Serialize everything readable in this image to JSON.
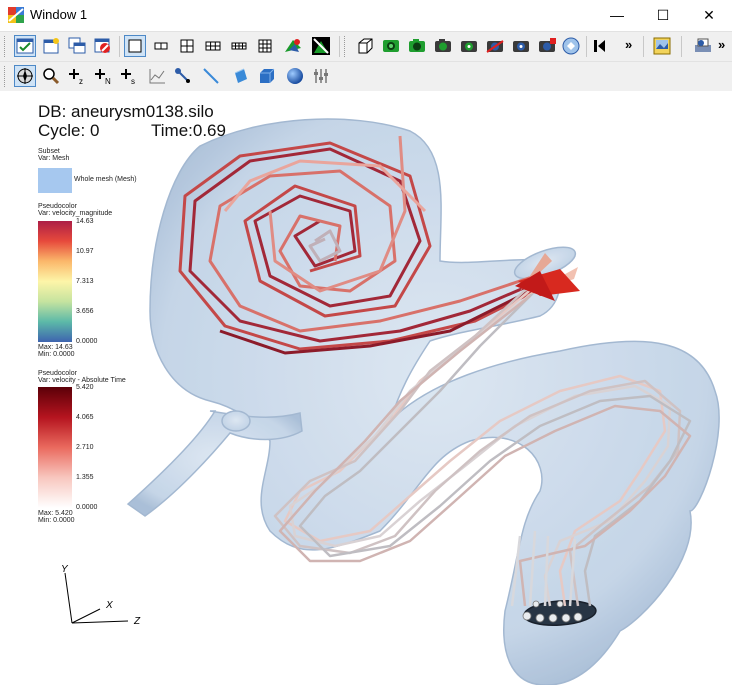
{
  "window": {
    "title": "Window 1",
    "minimize_glyph": "—",
    "maximize_glyph": "☐",
    "close_glyph": "✕"
  },
  "toolbar1": {
    "icons": [
      "toggle-spin-icon",
      "new-window-icon",
      "copy-window-icon",
      "delete-window-icon",
      "layout-1x1-icon",
      "layout-1x2-icon",
      "layout-2x2-icon",
      "layout-2x3-icon",
      "layout-2x4-icon",
      "layout-3x3-icon",
      "draw-plots-icon",
      "clear-plots-icon",
      "reset-view-icon",
      "save-view-icon",
      "view-camera-icon",
      "camera-icon",
      "camera-2-icon",
      "camera-3-icon",
      "camera-4-icon",
      "camera-5-icon",
      "camera-6-icon",
      "animation-back-icon"
    ],
    "overflow": "»",
    "extra_icons": [
      "save-image-icon",
      "print-icon"
    ]
  },
  "toolbar2": {
    "icons": [
      "navigate-mode-icon",
      "zoom-mode-icon",
      "zone-pick-icon",
      "node-pick-icon",
      "spreadsheet-pick-icon",
      "curve-lineout-icon",
      "line-pick-icon",
      "line-lineout-icon",
      "plane-tool-icon",
      "box-tool-icon",
      "sphere-tool-icon",
      "settings-sliders-icon"
    ]
  },
  "plot_info": {
    "db": "DB: aneurysm0138.silo",
    "cycle": "Cycle: 0",
    "time": "Time:0.69"
  },
  "legend_subset": {
    "title": "Subset",
    "var": "Var: Mesh",
    "entry": "Whole mesh (Mesh)",
    "swatch_color": "#a6c8ef"
  },
  "legend_pc1": {
    "title": "Pseudocolor",
    "var": "Var: velocity_magnitude",
    "ticks": [
      "14.63",
      "10.97",
      "7.313",
      "3.656",
      "0.0000"
    ],
    "max": "Max: 14.63",
    "min": "Min: 0.0000",
    "colors": [
      "#ad1e46",
      "#e74a3c",
      "#fbb86b",
      "#fdf5a8",
      "#c5e39f",
      "#5cb9a8",
      "#3e64af"
    ]
  },
  "legend_pc2": {
    "title": "Pseudocolor",
    "var": "Var: velocity - Absolute Time",
    "ticks": [
      "5.420",
      "4.065",
      "2.710",
      "1.355",
      "0.0000"
    ],
    "max": "Max: 5.420",
    "min": "Min: 0.0000",
    "colors": [
      "#5c0008",
      "#b5141f",
      "#ea6a5e",
      "#f8c7bf",
      "#ffffff"
    ]
  },
  "triad": {
    "y": "Y",
    "x": "X",
    "z": "Z"
  }
}
